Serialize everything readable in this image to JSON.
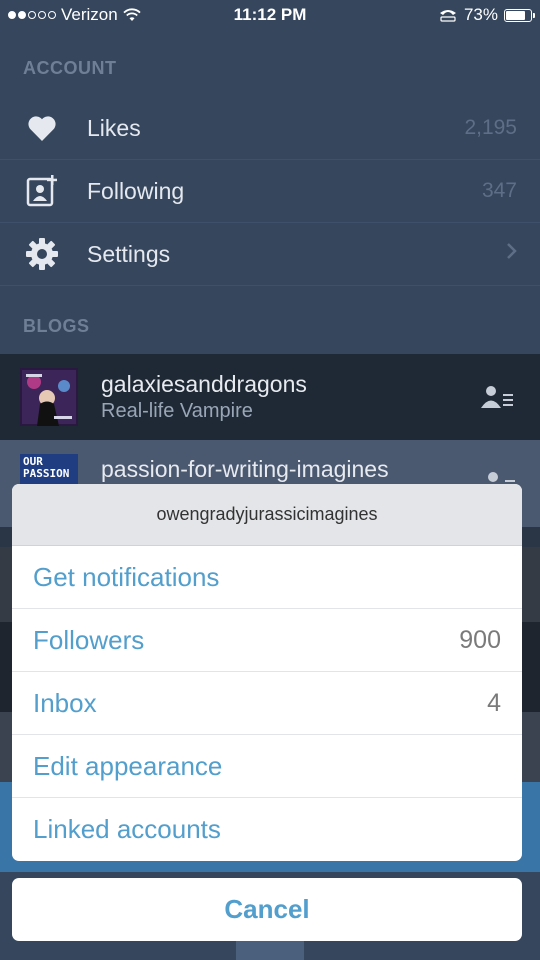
{
  "status_bar": {
    "carrier": "Verizon",
    "time": "11:12 PM",
    "battery": "73%",
    "battery_level": 0.73
  },
  "account": {
    "label": "ACCOUNT",
    "items": [
      {
        "label": "Likes",
        "count": "2,195"
      },
      {
        "label": "Following",
        "count": "347"
      },
      {
        "label": "Settings",
        "count": ""
      }
    ]
  },
  "blogs": {
    "label": "BLOGS",
    "items": [
      {
        "name": "galaxiesanddragons",
        "subtitle": "Real-life Vampire"
      },
      {
        "name": "passion-for-writing-imagines",
        "subtitle": "",
        "avatar_text": "OUR PASSION"
      }
    ]
  },
  "action_sheet": {
    "title": "owengradyjurassicimagines",
    "items": [
      {
        "label": "Get notifications",
        "value": ""
      },
      {
        "label": "Followers",
        "value": "900"
      },
      {
        "label": "Inbox",
        "value": "4"
      },
      {
        "label": "Edit appearance",
        "value": ""
      },
      {
        "label": "Linked accounts",
        "value": ""
      }
    ],
    "cancel": "Cancel"
  },
  "colors": {
    "background": "#36465d",
    "accent": "#529ecc"
  }
}
